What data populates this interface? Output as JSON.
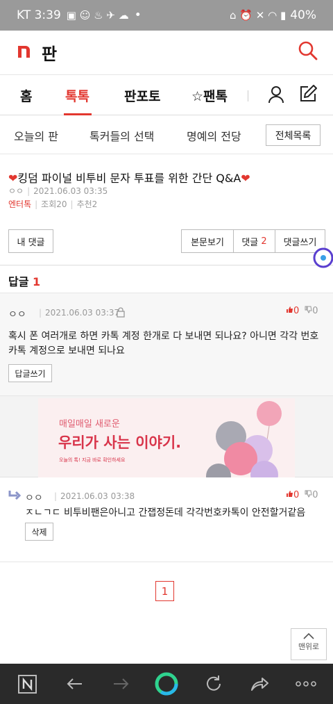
{
  "status_bar": {
    "carrier_time": "KT 3:39",
    "battery": "40%",
    "dot": "•"
  },
  "app": {
    "brand": "판"
  },
  "tabs": [
    {
      "label": "홈"
    },
    {
      "label": "톡톡"
    },
    {
      "label": "판포토"
    },
    {
      "label": "☆팬톡"
    }
  ],
  "subnav": {
    "items": [
      "오늘의 판",
      "톡커들의 선택",
      "명예의 전당"
    ],
    "all_button": "전체목록"
  },
  "post": {
    "heart": "❤",
    "title": "킹덤 파이널 비투비 문자 투표를 위한 간단 Q&A",
    "author": "ㅇㅇ",
    "date": "2021.06.03 03:35",
    "category": "엔터톡",
    "views": "조회20",
    "recommends": "추천2"
  },
  "actions": {
    "my_comments": "내 댓글",
    "view_body": "본문보기",
    "comments_label": "댓글",
    "comments_count": "2",
    "write_comment": "댓글쓰기"
  },
  "replies_header": {
    "label": "답글",
    "count": "1"
  },
  "comment": {
    "author": "ㅇㅇ",
    "date": "2021.06.03 03:37",
    "up": "0",
    "down": "0",
    "body": "혹시 폰 여러개로 하면 카톡 계정 한개로 다 보내면 되나요? 아니면 각각 번호 카톡 계정으로 보내면 되나요",
    "reply_button": "답글쓰기"
  },
  "ad": {
    "line1": "매일매일 새로운",
    "line2": "우리가 사는 이야기.",
    "line3": "오늘의 톡! 지금 바로 확인하세요"
  },
  "reply": {
    "author": "ㅇㅇ",
    "date": "2021.06.03 03:38",
    "up": "0",
    "down": "0",
    "body": "ㅈㄴㄱㄷ 비투비팬은아니고 간잽정돈데 각각번호카톡이 안전할거같음",
    "delete_button": "삭제"
  },
  "pagination": {
    "current": "1"
  },
  "to_top": {
    "label": "맨위로"
  },
  "colors": {
    "accent": "#e2372f",
    "status_bar": "#9a9a9a",
    "browser_bar": "#2a2a2a"
  },
  "icons": [
    "search-icon",
    "user-icon",
    "edit-icon",
    "lock-icon",
    "thumbs-up-icon",
    "thumbs-down-icon",
    "reply-arrow-icon",
    "back-icon",
    "forward-icon",
    "refresh-icon",
    "share-icon",
    "more-icon"
  ]
}
